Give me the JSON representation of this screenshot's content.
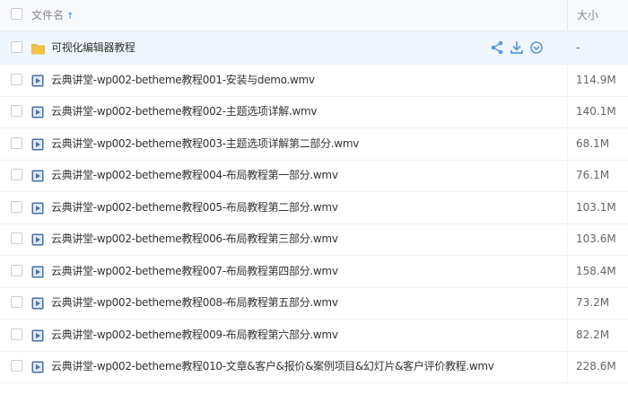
{
  "header": {
    "name_label": "文件名",
    "sort_indicator": "↑",
    "size_label": "大小"
  },
  "colors": {
    "folder": "#f5c244",
    "video_icon": "#4a6fa5",
    "action_icon": "#5b9bd5",
    "hover_row": "#f0f6fd"
  },
  "rows": [
    {
      "name": "可视化编辑器教程",
      "size": "-",
      "type": "folder",
      "hover": true
    },
    {
      "name": "云典讲堂-wp002-betheme教程001-安装与demo.wmv",
      "size": "114.9M",
      "type": "video"
    },
    {
      "name": "云典讲堂-wp002-betheme教程002-主题选项详解.wmv",
      "size": "140.1M",
      "type": "video"
    },
    {
      "name": "云典讲堂-wp002-betheme教程003-主题选项详解第二部分.wmv",
      "size": "68.1M",
      "type": "video"
    },
    {
      "name": "云典讲堂-wp002-betheme教程004-布局教程第一部分.wmv",
      "size": "76.1M",
      "type": "video"
    },
    {
      "name": "云典讲堂-wp002-betheme教程005-布局教程第二部分.wmv",
      "size": "103.1M",
      "type": "video"
    },
    {
      "name": "云典讲堂-wp002-betheme教程006-布局教程第三部分.wmv",
      "size": "103.6M",
      "type": "video"
    },
    {
      "name": "云典讲堂-wp002-betheme教程007-布局教程第四部分.wmv",
      "size": "158.4M",
      "type": "video"
    },
    {
      "name": "云典讲堂-wp002-betheme教程008-布局教程第五部分.wmv",
      "size": "73.2M",
      "type": "video"
    },
    {
      "name": "云典讲堂-wp002-betheme教程009-布局教程第六部分.wmv",
      "size": "82.2M",
      "type": "video"
    },
    {
      "name": "云典讲堂-wp002-betheme教程010-文章&客户&报价&案例项目&幻灯片&客户评价教程.wmv",
      "size": "228.6M",
      "type": "video"
    }
  ],
  "row_actions": [
    "share-icon",
    "download-icon",
    "more-icon"
  ]
}
